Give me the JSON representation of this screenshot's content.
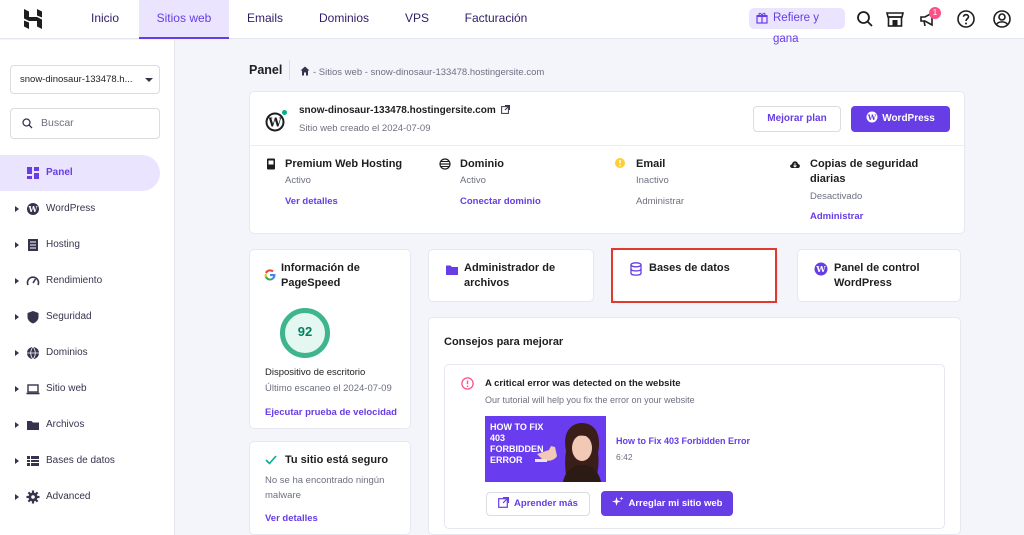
{
  "nav": {
    "tabs": [
      {
        "label": "Inicio"
      },
      {
        "label": "Sitios web"
      },
      {
        "label": "Emails"
      },
      {
        "label": "Dominios"
      },
      {
        "label": "VPS"
      },
      {
        "label": "Facturación"
      }
    ],
    "refer_label": "Refiere y gana",
    "notification_count": "1"
  },
  "sidebar": {
    "site_selector": "snow-dinosaur-133478.h...",
    "search_placeholder": "Buscar",
    "items": [
      {
        "label": "Panel",
        "icon": "panel-icon"
      },
      {
        "label": "WordPress",
        "icon": "wordpress-icon"
      },
      {
        "label": "Hosting",
        "icon": "hosting-icon"
      },
      {
        "label": "Rendimiento",
        "icon": "gauge-icon"
      },
      {
        "label": "Seguridad",
        "icon": "shield-icon"
      },
      {
        "label": "Dominios",
        "icon": "globe-icon"
      },
      {
        "label": "Sitio web",
        "icon": "laptop-icon"
      },
      {
        "label": "Archivos",
        "icon": "folder-icon"
      },
      {
        "label": "Bases de datos",
        "icon": "database-icon"
      },
      {
        "label": "Advanced",
        "icon": "gear-icon"
      }
    ]
  },
  "header": {
    "title": "Panel",
    "breadcrumb": "- Sitios web - snow-dinosaur-133478.hostingersite.com"
  },
  "site": {
    "name": "snow-dinosaur-133478.hostingersite.com",
    "created": "Sitio web creado el 2024-07-09",
    "upgrade_label": "Mejorar plan",
    "wordpress_label": "WordPress"
  },
  "services": [
    {
      "title": "Premium Web Hosting",
      "status": "Activo",
      "link": "Ver detalles"
    },
    {
      "title": "Dominio",
      "status": "Activo",
      "link": "Conectar dominio"
    },
    {
      "title": "Email",
      "status": "Inactivo",
      "link": "Administrar"
    },
    {
      "title": "Copias de seguridad diarias",
      "status": "Desactivado",
      "link": "Administrar"
    }
  ],
  "pagespeed": {
    "title": "Información de PageSpeed",
    "score": "92",
    "device": "Dispositivo de escritorio",
    "last_scan": "Último escaneo el 2024-07-09",
    "link": "Ejecutar prueba de velocidad"
  },
  "tiles": [
    {
      "label": "Administrador de archivos"
    },
    {
      "label": "Bases de datos"
    },
    {
      "label": "Panel de control WordPress"
    }
  ],
  "security": {
    "title": "Tu sitio está seguro",
    "desc": "No se ha encontrado ningún malware",
    "link": "Ver detalles"
  },
  "tips": {
    "title": "Consejos para mejorar",
    "alert_title": "A critical error was detected on the website",
    "alert_desc": "Our tutorial will help you fix the error on your website",
    "video_thumb_text": "HOW TO FIX\n403 FORBIDDEN\nERROR",
    "video_title": "How to Fix 403 Forbidden Error",
    "video_duration": "6:42",
    "learn_more": "Aprender más",
    "fix_site": "Arreglar mi sitio web"
  },
  "colors": {
    "accent": "#673de6",
    "accent_light": "#ebe4ff",
    "success": "#00b090",
    "error": "#fc5185",
    "highlight_box": "#e03a2f"
  }
}
